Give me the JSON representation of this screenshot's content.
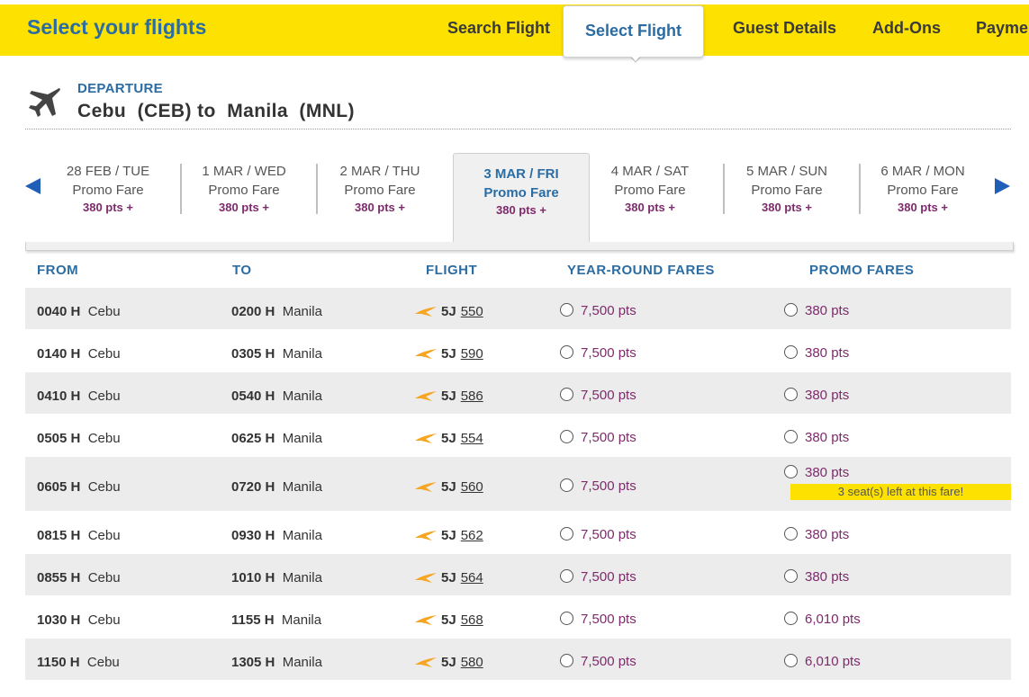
{
  "header": {
    "title": "Select your flights",
    "steps": [
      "Search Flight",
      "Select Flight",
      "Guest Details",
      "Add-Ons",
      "Payme"
    ]
  },
  "departure": {
    "label": "DEPARTURE",
    "route": "Cebu  (CEB) to  Manila  (MNL)"
  },
  "dates": [
    {
      "date": "28 FEB / TUE",
      "fare": "Promo Fare",
      "pts": "380 pts +"
    },
    {
      "date": "1 MAR / WED",
      "fare": "Promo Fare",
      "pts": "380 pts +"
    },
    {
      "date": "2 MAR / THU",
      "fare": "Promo Fare",
      "pts": "380 pts +"
    },
    {
      "date": "3 MAR / FRI",
      "fare": "Promo Fare",
      "pts": "380 pts +"
    },
    {
      "date": "4 MAR / SAT",
      "fare": "Promo Fare",
      "pts": "380 pts +"
    },
    {
      "date": "5 MAR / SUN",
      "fare": "Promo Fare",
      "pts": "380 pts +"
    },
    {
      "date": "6 MAR / MON",
      "fare": "Promo Fare",
      "pts": "380 pts +"
    }
  ],
  "table": {
    "headers": [
      "FROM",
      "TO",
      "FLIGHT",
      "YEAR-ROUND FARES",
      "PROMO FARES"
    ],
    "rows": [
      {
        "dep": "0040 H",
        "from": "Cebu",
        "arr": "0200 H",
        "to": "Manila",
        "code": "5J",
        "num": "550",
        "yr": "7,500 pts",
        "promo": "380 pts",
        "note": ""
      },
      {
        "dep": "0140 H",
        "from": "Cebu",
        "arr": "0305 H",
        "to": "Manila",
        "code": "5J",
        "num": "590",
        "yr": "7,500 pts",
        "promo": "380 pts",
        "note": ""
      },
      {
        "dep": "0410 H",
        "from": "Cebu",
        "arr": "0540 H",
        "to": "Manila",
        "code": "5J",
        "num": "586",
        "yr": "7,500 pts",
        "promo": "380 pts",
        "note": ""
      },
      {
        "dep": "0505 H",
        "from": "Cebu",
        "arr": "0625 H",
        "to": "Manila",
        "code": "5J",
        "num": "554",
        "yr": "7,500 pts",
        "promo": "380 pts",
        "note": ""
      },
      {
        "dep": "0605 H",
        "from": "Cebu",
        "arr": "0720 H",
        "to": "Manila",
        "code": "5J",
        "num": "560",
        "yr": "7,500 pts",
        "promo": "380 pts",
        "note": "3 seat(s) left at this fare!"
      },
      {
        "dep": "0815 H",
        "from": "Cebu",
        "arr": "0930 H",
        "to": "Manila",
        "code": "5J",
        "num": "562",
        "yr": "7,500 pts",
        "promo": "380 pts",
        "note": ""
      },
      {
        "dep": "0855 H",
        "from": "Cebu",
        "arr": "1010 H",
        "to": "Manila",
        "code": "5J",
        "num": "564",
        "yr": "7,500 pts",
        "promo": "380 pts",
        "note": ""
      },
      {
        "dep": "1030 H",
        "from": "Cebu",
        "arr": "1155 H",
        "to": "Manila",
        "code": "5J",
        "num": "568",
        "yr": "7,500 pts",
        "promo": "6,010 pts",
        "note": ""
      },
      {
        "dep": "1150 H",
        "from": "Cebu",
        "arr": "1305 H",
        "to": "Manila",
        "code": "5J",
        "num": "580",
        "yr": "7,500 pts",
        "promo": "6,010 pts",
        "note": ""
      }
    ]
  },
  "colors": {
    "brand_yellow": "#fde100",
    "brand_blue": "#2b6ca3",
    "points_purple": "#7d2a6b"
  }
}
